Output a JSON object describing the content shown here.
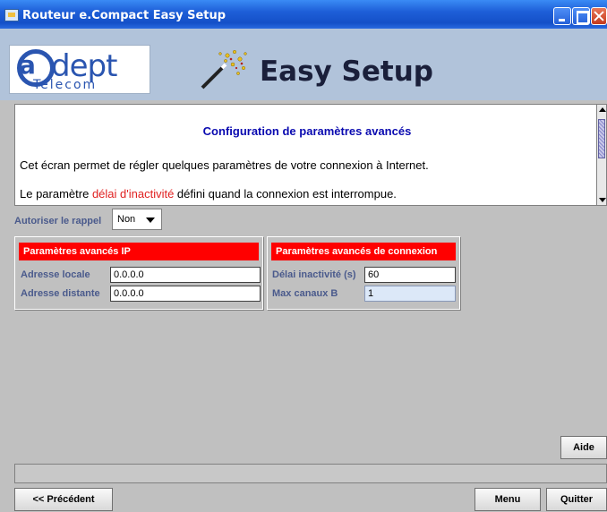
{
  "window": {
    "title": "Routeur e.Compact Easy Setup"
  },
  "header": {
    "logo_word": "dept",
    "logo_letter": "a",
    "logo_sub": "Telecom",
    "banner": "Easy Setup"
  },
  "info": {
    "heading": "Configuration de paramètres avancés",
    "line1": "Cet écran permet de régler quelques paramètres de votre connexion à Internet.",
    "line2_before": "Le paramètre ",
    "line2_highlight": "délai d'inactivité",
    "line2_after": " défini quand la connexion est interrompue."
  },
  "rappel": {
    "label": "Autoriser le rappel",
    "value": "Non"
  },
  "panel_ip": {
    "title": "Paramètres avancés IP",
    "local_label": "Adresse locale",
    "local_value": "0.0.0.0",
    "remote_label": "Adresse distante",
    "remote_value": "0.0.0.0"
  },
  "panel_conn": {
    "title": "Paramètres avancés de connexion",
    "delay_label": "Délai inactivité (s)",
    "delay_value": "60",
    "channels_label": "Max canaux B",
    "channels_value": "1"
  },
  "buttons": {
    "help": "Aide",
    "previous": "<< Précédent",
    "menu": "Menu",
    "quit": "Quitter"
  },
  "colors": {
    "title_bar": "#1e5fd8",
    "header_bg": "#b1c3da",
    "heading_blue": "#0a0ab0",
    "panel_header_red": "#ff0000",
    "highlight_red": "#e02020"
  }
}
